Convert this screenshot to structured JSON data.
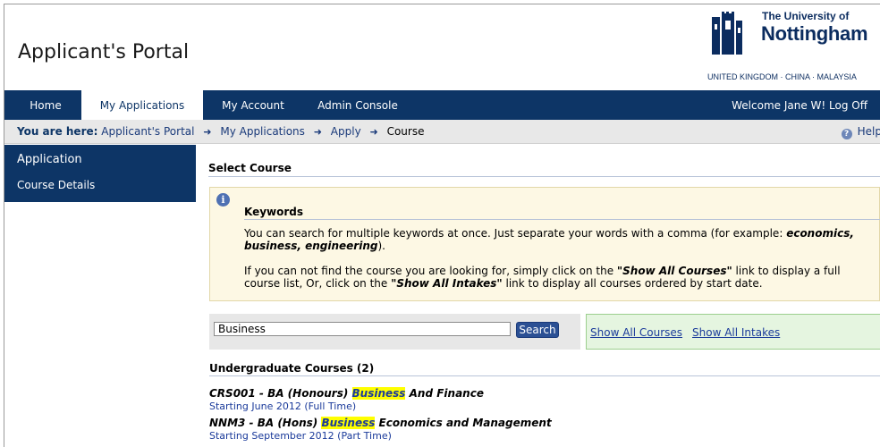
{
  "header": {
    "app_title": "Applicant's Portal",
    "logo_line1": "The University of",
    "logo_line2": "Nottingham",
    "logo_sub": "UNITED KINGDOM · CHINA · MALAYSIA"
  },
  "nav": {
    "items": [
      {
        "label": "Home"
      },
      {
        "label": "My Applications"
      },
      {
        "label": "My Account"
      },
      {
        "label": "Admin Console"
      }
    ],
    "welcome": "Welcome Jane W!",
    "logoff": "Log Off"
  },
  "breadcrumb": {
    "prefix": "You are here:",
    "items": [
      "Applicant's Portal",
      "My Applications",
      "Apply",
      "Course"
    ],
    "help": "Help"
  },
  "sidebar": {
    "heading": "Application",
    "items": [
      "Course Details"
    ]
  },
  "main": {
    "section_title": "Select Course",
    "keywords": {
      "title": "Keywords",
      "p1_text": "You can search for multiple keywords at once. Just separate your words with a comma (for example: ",
      "p1_example": "economics, business, engineering",
      "p1_end": ").",
      "p2_a": "If you can not find the course you are looking for, simply click on the ",
      "p2_link1": "\"Show All Courses\"",
      "p2_b": " link to display a full course list, Or, click on the ",
      "p2_link2": "\"Show All Intakes\"",
      "p2_c": " link to display all courses ordered by start date."
    },
    "search": {
      "value": "Business",
      "button": "Search"
    },
    "show_all_courses": "Show All Courses",
    "show_all_intakes": "Show All Intakes",
    "ug_title": "Undergraduate Courses (2)",
    "courses": [
      {
        "pre": "CRS001 - BA (Honours) ",
        "hl": "Business",
        "post": " And Finance",
        "start": "Starting June 2012 (Full Time)"
      },
      {
        "pre": "NNM3 - BA (Hons) ",
        "hl": "Business",
        "post": " Economics and Management",
        "start": "Starting September 2012 (Part Time)"
      }
    ]
  }
}
